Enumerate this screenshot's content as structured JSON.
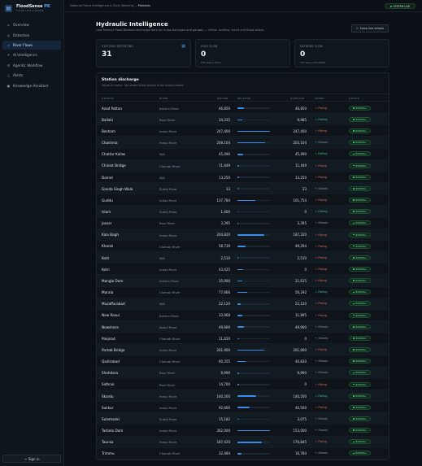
{
  "brand": {
    "logo": "▤",
    "name": "FloodSense",
    "suffix": "PK",
    "tagline": "FLOOD INTELLIGENCE"
  },
  "nav": [
    {
      "icon": "⌂",
      "icon_name": "home-icon",
      "label": "Overview"
    },
    {
      "icon": "◎",
      "icon_name": "target-icon",
      "label": "Detection"
    },
    {
      "icon": "≈",
      "icon_name": "waves-icon",
      "label": "River Flows",
      "active": true
    },
    {
      "icon": "✦",
      "icon_name": "sparkle-icon",
      "label": "AI Intelligence"
    },
    {
      "icon": "⚙",
      "icon_name": "workflow-icon",
      "label": "Agentic Workflow"
    },
    {
      "icon": "△",
      "icon_name": "alert-icon",
      "label": "Alerts"
    },
    {
      "icon": "▣",
      "icon_name": "assistant-icon",
      "label": "Knowledge Assistant"
    }
  ],
  "signin": {
    "icon": "⇥",
    "label": "Sign in"
  },
  "topbar": {
    "breadcrumb_prefix": "National Flood Intelligence & Early Warning —",
    "breadcrumb_current": "Pakistan",
    "live_label": "SYSTEM LIVE"
  },
  "header": {
    "title": "Hydraulic Intelligence",
    "subtitle": "Live Federal Flood Division discharge data for Indus barrages and gauges — inflow, outflow, trend and flood status.",
    "refresh_label": "Force live refresh",
    "refresh_icon": "↻"
  },
  "kpis": [
    {
      "label": "STATIONS REPORTING",
      "value": "31",
      "note": "",
      "icon": "▦"
    },
    {
      "label": "HIGH FLOW",
      "value": "0",
      "note": "FFD status HIGH",
      "icon": ""
    },
    {
      "label": "EXTREME FLOW",
      "value": "0",
      "note": "FFD status EXTREME",
      "icon": ""
    }
  ],
  "panel": {
    "title": "Station discharge",
    "subtitle": "Values in cusecs · bar shows inflow relative to the busiest station",
    "columns": [
      "STATION",
      "RIVER",
      "INFLOW",
      "RELATIVE",
      "OUTFLOW",
      "TREND",
      "STATUS"
    ]
  },
  "trend_glyphs": {
    "Rising": "↗",
    "Falling": "↘",
    "Steady": "→"
  },
  "stations": [
    {
      "station": "Azad Pattan",
      "river": "Jhelum River",
      "inflow": "46,850",
      "outflow": "46,850",
      "trend": "Rising",
      "status": "NORMAL",
      "relative": 0.19
    },
    {
      "station": "Balloki",
      "river": "Ravi River",
      "inflow": "34,335",
      "outflow": "9,985",
      "trend": "Falling",
      "status": "NORMAL",
      "relative": 0.14
    },
    {
      "station": "Besham",
      "river": "Indus River",
      "inflow": "247,400",
      "outflow": "247,400",
      "trend": "Rising",
      "status": "NORMAL",
      "relative": 1.0
    },
    {
      "station": "Chashma",
      "river": "Indus River",
      "inflow": "208,104",
      "outflow": "203,104",
      "trend": "Steady",
      "status": "NORMAL",
      "relative": 0.84
    },
    {
      "station": "Chattar Kallas",
      "river": "N/A",
      "inflow": "45,490",
      "outflow": "45,490",
      "trend": "Falling",
      "status": "NORMAL",
      "relative": 0.18
    },
    {
      "station": "Chiniot Bridge",
      "river": "Chenab River",
      "inflow": "11,449",
      "outflow": "11,449",
      "trend": "Rising",
      "status": "NORMAL",
      "relative": 0.05
    },
    {
      "station": "Domel",
      "river": "N/A",
      "inflow": "13,250",
      "outflow": "13,250",
      "trend": "Rising",
      "status": "NORMAL",
      "relative": 0.05
    },
    {
      "station": "Ganda Singh Wala",
      "river": "Sutlej River",
      "inflow": "33",
      "outflow": "33",
      "trend": "Steady",
      "status": "NORMAL",
      "relative": 0.0
    },
    {
      "station": "Guddu",
      "river": "Indus River",
      "inflow": "137,784",
      "outflow": "101,754",
      "trend": "Rising",
      "status": "NORMAL",
      "relative": 0.56
    },
    {
      "station": "Islam",
      "river": "Sutlej River",
      "inflow": "1,400",
      "outflow": "0",
      "trend": "Falling",
      "status": "NORMAL",
      "relative": 0.01
    },
    {
      "station": "Jassar",
      "river": "Ravi River",
      "inflow": "3,395",
      "outflow": "3,395",
      "trend": "Steady",
      "status": "NORMAL",
      "relative": 0.01
    },
    {
      "station": "Kala Bagh",
      "river": "Indus River",
      "inflow": "204,820",
      "outflow": "187,320",
      "trend": "Rising",
      "status": "NORMAL",
      "relative": 0.83
    },
    {
      "station": "Khanki",
      "river": "Chenab River",
      "inflow": "58,739",
      "outflow": "49,294",
      "trend": "Rising",
      "status": "NORMAL",
      "relative": 0.24
    },
    {
      "station": "Kotli",
      "river": "N/A",
      "inflow": "2,510",
      "outflow": "2,510",
      "trend": "Rising",
      "status": "NORMAL",
      "relative": 0.01
    },
    {
      "station": "Kotri",
      "river": "Indus River",
      "inflow": "43,425",
      "outflow": "0",
      "trend": "Rising",
      "status": "NORMAL",
      "relative": 0.18
    },
    {
      "station": "Mangla Dam",
      "river": "Jhelum River",
      "inflow": "35,000",
      "outflow": "21,615",
      "trend": "Rising",
      "status": "NORMAL",
      "relative": 0.14
    },
    {
      "station": "Marala",
      "river": "Chenab River",
      "inflow": "77,666",
      "outflow": "50,292",
      "trend": "Falling",
      "status": "NORMAL",
      "relative": 0.31
    },
    {
      "station": "Muzaffarabad",
      "river": "N/A",
      "inflow": "22,120",
      "outflow": "22,120",
      "trend": "Rising",
      "status": "NORMAL",
      "relative": 0.09
    },
    {
      "station": "New Rasul",
      "river": "Jhelum River",
      "inflow": "33,968",
      "outflow": "11,895",
      "trend": "Rising",
      "status": "NORMAL",
      "relative": 0.14
    },
    {
      "station": "Nowshera",
      "river": "Kabul River",
      "inflow": "49,900",
      "outflow": "49,900",
      "trend": "Steady",
      "status": "NORMAL",
      "relative": 0.2
    },
    {
      "station": "Panjnad",
      "river": "Chenab River",
      "inflow": "11,650",
      "outflow": "0",
      "trend": "Steady",
      "status": "NORMAL",
      "relative": 0.05
    },
    {
      "station": "Partab Bridge",
      "river": "Indus River",
      "inflow": "201,900",
      "outflow": "201,900",
      "trend": "Rising",
      "status": "NORMAL",
      "relative": 0.82
    },
    {
      "station": "Qadirabad",
      "river": "Chenab River",
      "inflow": "60,355",
      "outflow": "40,830",
      "trend": "Steady",
      "status": "NORMAL",
      "relative": 0.24
    },
    {
      "station": "Shahdara",
      "river": "Ravi River",
      "inflow": "9,990",
      "outflow": "9,990",
      "trend": "Steady",
      "status": "NORMAL",
      "relative": 0.04
    },
    {
      "station": "Sidhnai",
      "river": "Ravi River",
      "inflow": "14,700",
      "outflow": "0",
      "trend": "Rising",
      "status": "NORMAL",
      "relative": 0.06
    },
    {
      "station": "Skardu",
      "river": "Indus River",
      "inflow": "140,200",
      "outflow": "140,200",
      "trend": "Falling",
      "status": "NORMAL",
      "relative": 0.57
    },
    {
      "station": "Sukkur",
      "river": "Indus River",
      "inflow": "92,600",
      "outflow": "40,500",
      "trend": "Rising",
      "status": "NORMAL",
      "relative": 0.37
    },
    {
      "station": "Sulemanki",
      "river": "Sutlej River",
      "inflow": "15,182",
      "outflow": "3,075",
      "trend": "Steady",
      "status": "NORMAL",
      "relative": 0.06
    },
    {
      "station": "Tarbela Dam",
      "river": "Indus River",
      "inflow": "262,000",
      "outflow": "153,000",
      "trend": "Steady",
      "status": "NORMAL",
      "relative": 1.0
    },
    {
      "station": "Taunsa",
      "river": "Indus River",
      "inflow": "187,420",
      "outflow": "170,845",
      "trend": "Rising",
      "status": "NORMAL",
      "relative": 0.76
    },
    {
      "station": "Trimmu",
      "river": "Chenab River",
      "inflow": "32,484",
      "outflow": "16,784",
      "trend": "Steady",
      "status": "NORMAL",
      "relative": 0.13
    }
  ]
}
